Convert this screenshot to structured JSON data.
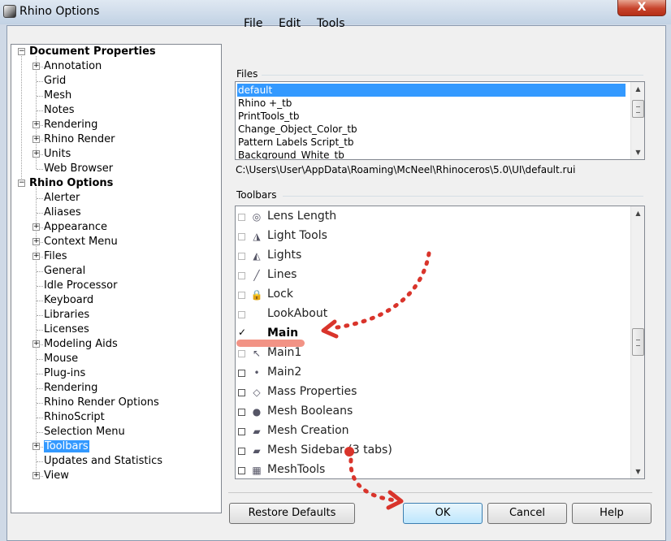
{
  "window": {
    "title": "Rhino Options",
    "close_label": "X"
  },
  "tree": {
    "nodes": [
      {
        "label": "Document Properties",
        "level": 0,
        "expander": "−",
        "cat": true
      },
      {
        "label": "Annotation",
        "level": 1,
        "expander": "+"
      },
      {
        "label": "Grid",
        "level": 1
      },
      {
        "label": "Mesh",
        "level": 1
      },
      {
        "label": "Notes",
        "level": 1
      },
      {
        "label": "Rendering",
        "level": 1,
        "expander": "+"
      },
      {
        "label": "Rhino Render",
        "level": 1,
        "expander": "+"
      },
      {
        "label": "Units",
        "level": 1,
        "expander": "+"
      },
      {
        "label": "Web Browser",
        "level": 1
      },
      {
        "label": "Rhino Options",
        "level": 0,
        "expander": "−",
        "cat": true
      },
      {
        "label": "Alerter",
        "level": 1
      },
      {
        "label": "Aliases",
        "level": 1
      },
      {
        "label": "Appearance",
        "level": 1,
        "expander": "+"
      },
      {
        "label": "Context Menu",
        "level": 1,
        "expander": "+"
      },
      {
        "label": "Files",
        "level": 1,
        "expander": "+"
      },
      {
        "label": "General",
        "level": 1
      },
      {
        "label": "Idle Processor",
        "level": 1
      },
      {
        "label": "Keyboard",
        "level": 1
      },
      {
        "label": "Libraries",
        "level": 1
      },
      {
        "label": "Licenses",
        "level": 1
      },
      {
        "label": "Modeling Aids",
        "level": 1,
        "expander": "+"
      },
      {
        "label": "Mouse",
        "level": 1
      },
      {
        "label": "Plug-ins",
        "level": 1
      },
      {
        "label": "Rendering",
        "level": 1
      },
      {
        "label": "Rhino Render Options",
        "level": 1
      },
      {
        "label": "RhinoScript",
        "level": 1
      },
      {
        "label": "Selection Menu",
        "level": 1
      },
      {
        "label": "Toolbars",
        "level": 1,
        "expander": "+",
        "selected": true
      },
      {
        "label": "Updates and Statistics",
        "level": 1
      },
      {
        "label": "View",
        "level": 1,
        "expander": "+"
      }
    ]
  },
  "menu": {
    "file": "File",
    "edit": "Edit",
    "tools": "Tools"
  },
  "files": {
    "label": "Files",
    "items": [
      "default",
      "Rhino +_tb",
      "PrintTools_tb",
      "Change_Object_Color_tb",
      "Pattern Labels Script_tb",
      "Background_White_tb"
    ],
    "selected_index": 0,
    "path": "C:\\Users\\User\\AppData\\Roaming\\McNeel\\Rhinoceros\\5.0\\UI\\default.rui"
  },
  "toolbars": {
    "label": "Toolbars",
    "items": [
      {
        "label": "Lens Length",
        "icon": "lens-length-icon",
        "glyph": "◎",
        "check": "off"
      },
      {
        "label": "Light Tools",
        "icon": "light-tools-icon",
        "glyph": "◮",
        "check": "off"
      },
      {
        "label": "Lights",
        "icon": "lights-icon",
        "glyph": "◭",
        "check": "off"
      },
      {
        "label": "Lines",
        "icon": "lines-icon",
        "glyph": "╱",
        "check": "off"
      },
      {
        "label": "Lock",
        "icon": "lock-icon",
        "glyph": "🔒",
        "check": "off"
      },
      {
        "label": "LookAbout",
        "icon": "",
        "glyph": "",
        "check": "off"
      },
      {
        "label": "Main",
        "icon": "",
        "glyph": "",
        "check": "on",
        "bold": true
      },
      {
        "label": "Main1",
        "icon": "cursor-icon",
        "glyph": "↖",
        "check": "off"
      },
      {
        "label": "Main2",
        "icon": "dot-icon",
        "glyph": "•",
        "check": "strong"
      },
      {
        "label": "Mass Properties",
        "icon": "mass-properties-icon",
        "glyph": "◇",
        "check": "strong"
      },
      {
        "label": "Mesh Booleans",
        "icon": "mesh-booleans-icon",
        "glyph": "●",
        "check": "strong"
      },
      {
        "label": "Mesh Creation",
        "icon": "mesh-creation-icon",
        "glyph": "▰",
        "check": "strong"
      },
      {
        "label": "Mesh Sidebar (3 tabs)",
        "icon": "mesh-sidebar-icon",
        "glyph": "▰",
        "check": "strong"
      },
      {
        "label": "MeshTools",
        "icon": "mesh-tools-icon",
        "glyph": "▦",
        "check": "strong"
      }
    ]
  },
  "buttons": {
    "restore_defaults": "Restore Defaults",
    "ok": "OK",
    "cancel": "Cancel",
    "help": "Help"
  },
  "colors": {
    "selection": "#3399ff",
    "annotation": "#d9342b",
    "highlight": "#f08070"
  }
}
